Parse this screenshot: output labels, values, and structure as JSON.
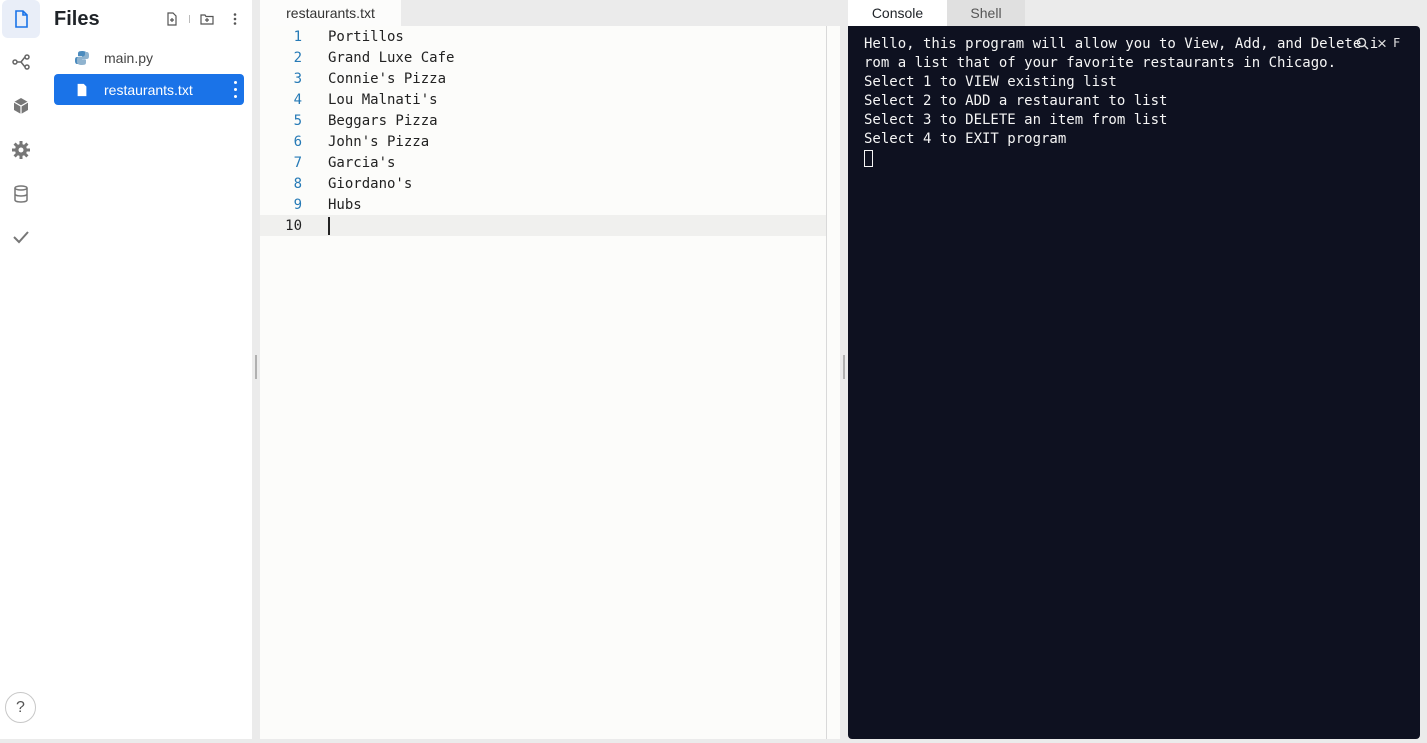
{
  "activity_bar": {
    "items": [
      {
        "name": "files",
        "icon": "file-icon",
        "active": true
      },
      {
        "name": "version-control",
        "icon": "git-branch-icon"
      },
      {
        "name": "packages",
        "icon": "package-icon"
      },
      {
        "name": "settings",
        "icon": "gear-icon"
      },
      {
        "name": "database",
        "icon": "database-icon"
      },
      {
        "name": "unit-tests",
        "icon": "checkmark-icon"
      }
    ],
    "help_label": "?"
  },
  "files_panel": {
    "title": "Files",
    "files": [
      {
        "name": "main.py",
        "icon": "python-icon",
        "selected": false
      },
      {
        "name": "restaurants.txt",
        "icon": "file-icon",
        "selected": true
      }
    ]
  },
  "editor": {
    "tab_label": "restaurants.txt",
    "lines": [
      {
        "n": "1",
        "text": "Portillos"
      },
      {
        "n": "2",
        "text": "Grand Luxe Cafe"
      },
      {
        "n": "3",
        "text": "Connie's Pizza"
      },
      {
        "n": "4",
        "text": "Lou Malnati's"
      },
      {
        "n": "5",
        "text": "Beggars Pizza"
      },
      {
        "n": "6",
        "text": "John's Pizza"
      },
      {
        "n": "7",
        "text": "Garcia's"
      },
      {
        "n": "8",
        "text": "Giordano's"
      },
      {
        "n": "9",
        "text": "Hubs"
      },
      {
        "n": "10",
        "text": ""
      }
    ],
    "current_line": "10"
  },
  "console": {
    "tabs": [
      {
        "label": "Console",
        "active": true
      },
      {
        "label": "Shell",
        "active": false
      }
    ],
    "output": [
      "Hello, this program will allow you to View, Add, and Delete i",
      "rom a list that of your favorite restaurants in Chicago.",
      "Select 1 to VIEW existing list",
      "Select 2 to ADD a restaurant to list",
      "Select 3 to DELETE an item from list",
      "Select 4 to EXIT program"
    ],
    "overlay_char": "F",
    "close_glyph": "×"
  },
  "colors": {
    "accent": "#1a73e8",
    "console_bg": "#0e1120",
    "line_number": "#267ab6",
    "editor_bg": "#fcfcfa"
  }
}
